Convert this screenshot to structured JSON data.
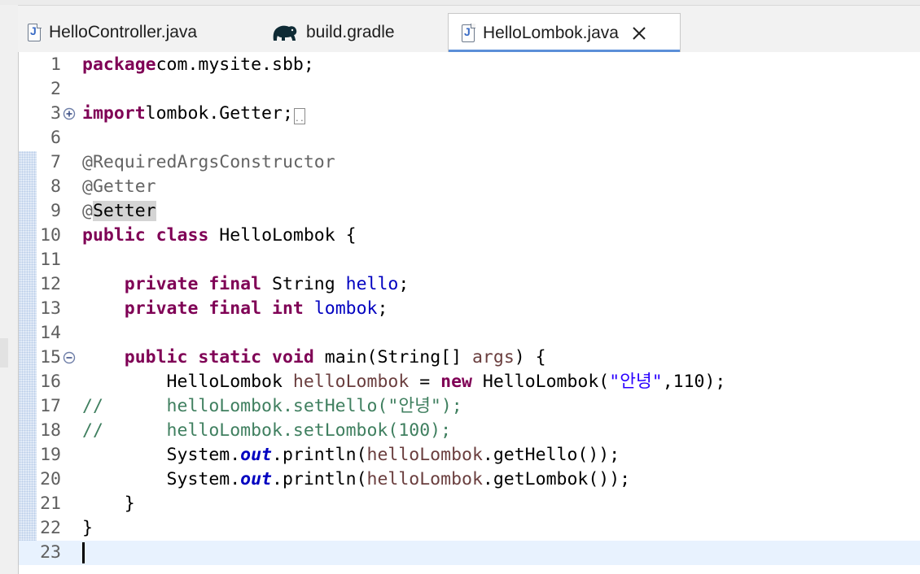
{
  "tabs": [
    {
      "label": "HelloController.java",
      "icon": "java-file-icon",
      "active": false
    },
    {
      "label": "build.gradle",
      "icon": "gradle-elephant-icon",
      "active": false
    },
    {
      "label": "HelloLombok.java",
      "icon": "java-file-icon",
      "active": true
    }
  ],
  "colors": {
    "keyword": "#7f0055",
    "annotation": "#646464",
    "field": "#0000c0",
    "string": "#2a00ff",
    "comment": "#3f7f5f",
    "local_variable": "#6a3e3e",
    "current_line": "#e8f2fe",
    "active_tab_underline": "#5b8fd8"
  },
  "editor": {
    "current_line": 23,
    "lines": [
      {
        "n": "1",
        "tokens": [
          [
            "kw",
            "package"
          ],
          [
            "",
            "com.mysite.sbb;"
          ]
        ]
      },
      {
        "n": "2",
        "tokens": []
      },
      {
        "n": "3",
        "fold": "expand",
        "tokens": [
          [
            "kw",
            "import"
          ],
          [
            "",
            "lombok.Getter;"
          ]
        ],
        "collapsed": ".."
      },
      {
        "n": "6",
        "tokens": []
      },
      {
        "n": "7",
        "tokens": [
          [
            "ann",
            "@RequiredArgsConstructor"
          ]
        ]
      },
      {
        "n": "8",
        "tokens": [
          [
            "ann",
            "@Getter"
          ]
        ]
      },
      {
        "n": "9",
        "tokens": [
          [
            "ann",
            "@"
          ],
          [
            "ann-hl",
            "Setter"
          ]
        ]
      },
      {
        "n": "10",
        "tokens": [
          [
            "kw",
            "public"
          ],
          [
            "",
            " "
          ],
          [
            "kw",
            "class"
          ],
          [
            "",
            " HelloLombok {"
          ]
        ]
      },
      {
        "n": "11",
        "tokens": []
      },
      {
        "n": "12",
        "tokens": [
          [
            "",
            "    "
          ],
          [
            "kw",
            "private"
          ],
          [
            "",
            " "
          ],
          [
            "kw",
            "final"
          ],
          [
            "",
            " String "
          ],
          [
            "fld",
            "hello"
          ],
          [
            "",
            ";"
          ]
        ]
      },
      {
        "n": "13",
        "tokens": [
          [
            "",
            "    "
          ],
          [
            "kw",
            "private"
          ],
          [
            "",
            " "
          ],
          [
            "kw",
            "final"
          ],
          [
            "",
            " "
          ],
          [
            "kw",
            "int"
          ],
          [
            "",
            " "
          ],
          [
            "fld",
            "lombok"
          ],
          [
            "",
            ";"
          ]
        ]
      },
      {
        "n": "14",
        "tokens": []
      },
      {
        "n": "15",
        "fold": "collapse",
        "tokens": [
          [
            "",
            "    "
          ],
          [
            "kw",
            "public"
          ],
          [
            "",
            " "
          ],
          [
            "kw",
            "static"
          ],
          [
            "",
            " "
          ],
          [
            "kw",
            "void"
          ],
          [
            "",
            " main(String[] "
          ],
          [
            "lvar",
            "args"
          ],
          [
            "",
            ") {"
          ]
        ]
      },
      {
        "n": "16",
        "tokens": [
          [
            "",
            "        HelloLombok "
          ],
          [
            "lvar",
            "helloLombok"
          ],
          [
            "",
            " = "
          ],
          [
            "kw",
            "new"
          ],
          [
            "",
            " HelloLombok("
          ],
          [
            "str",
            "\"안녕\""
          ],
          [
            "",
            ",110);"
          ]
        ]
      },
      {
        "n": "17",
        "tokens": [
          [
            "cmt",
            "//      helloLombok.setHello(\"안녕\");"
          ]
        ]
      },
      {
        "n": "18",
        "tokens": [
          [
            "cmt",
            "//      helloLombok.setLombok(100);"
          ]
        ]
      },
      {
        "n": "19",
        "tokens": [
          [
            "",
            "        System."
          ],
          [
            "sfld",
            "out"
          ],
          [
            "",
            ".println("
          ],
          [
            "lvar",
            "helloLombok"
          ],
          [
            "",
            ".getHello());"
          ]
        ]
      },
      {
        "n": "20",
        "tokens": [
          [
            "",
            "        System."
          ],
          [
            "sfld",
            "out"
          ],
          [
            "",
            ".println("
          ],
          [
            "lvar",
            "helloLombok"
          ],
          [
            "",
            ".getLombok());"
          ]
        ]
      },
      {
        "n": "21",
        "tokens": [
          [
            "",
            "    }"
          ]
        ]
      },
      {
        "n": "22",
        "tokens": [
          [
            "",
            "}"
          ]
        ]
      },
      {
        "n": "23",
        "tokens": []
      }
    ]
  }
}
